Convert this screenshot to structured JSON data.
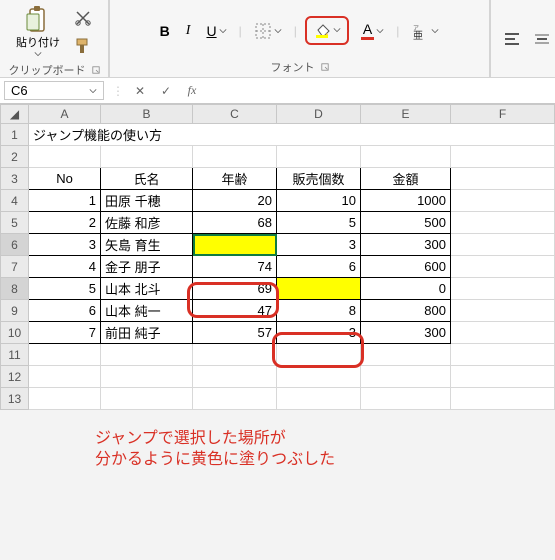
{
  "ribbon": {
    "paste_label": "貼り付け",
    "clipboard_group": "クリップボード",
    "font_group": "フォント",
    "bold": "B",
    "italic": "I",
    "underline": "U",
    "font_color": "A"
  },
  "namebox": {
    "cell_ref": "C6"
  },
  "sheet": {
    "title_cell": "ジャンプ機能の使い方",
    "headers": {
      "no": "No",
      "name": "氏名",
      "age": "年齢",
      "qty": "販売個数",
      "amount": "金額"
    },
    "rows": [
      {
        "no": "1",
        "name": "田原 千穂",
        "age": "20",
        "qty": "10",
        "amount": "1000"
      },
      {
        "no": "2",
        "name": "佐藤 和彦",
        "age": "68",
        "qty": "5",
        "amount": "500"
      },
      {
        "no": "3",
        "name": "矢島 育生",
        "age": "",
        "qty": "3",
        "amount": "300"
      },
      {
        "no": "4",
        "name": "金子 朋子",
        "age": "74",
        "qty": "6",
        "amount": "600"
      },
      {
        "no": "5",
        "name": "山本 北斗",
        "age": "69",
        "qty": "",
        "amount": "0"
      },
      {
        "no": "6",
        "name": "山本 純一",
        "age": "47",
        "qty": "8",
        "amount": "800"
      },
      {
        "no": "7",
        "name": "前田 純子",
        "age": "57",
        "qty": "3",
        "amount": "300"
      }
    ],
    "annotation": "ジャンプで選択した場所が\n分かるように黄色に塗りつぶした"
  },
  "cols": [
    "A",
    "B",
    "C",
    "D",
    "E",
    "F"
  ]
}
